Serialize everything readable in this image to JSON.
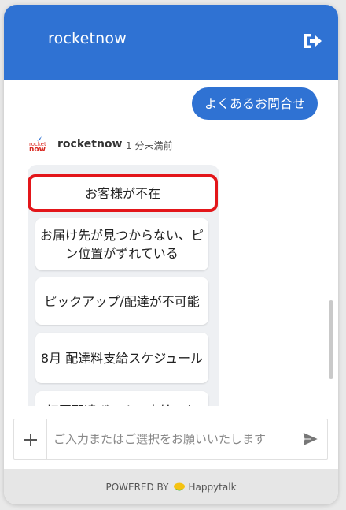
{
  "header": {
    "title": "rocketnow",
    "exit_icon": "exit-icon"
  },
  "chat": {
    "user_message": "よくあるお問合せ",
    "bot": {
      "avatar_line1": "rocket",
      "avatar_line2": "now",
      "name": "rocketnow",
      "time": "1 分未満前"
    },
    "options": [
      {
        "label": "お客様が不在",
        "selected": true
      },
      {
        "label": "お届け先が見つからない、ピン位置がずれている"
      },
      {
        "label": "ピックアップ/配達が不可能"
      },
      {
        "label": "8月 配達料支給スケジュール"
      },
      {
        "label": "初回配達ボーナス支給スケ"
      }
    ]
  },
  "input": {
    "placeholder": "ご入力またはご選択をお願いいたします",
    "value": ""
  },
  "footer": {
    "powered_by": "POWERED BY",
    "brand": "Happytalk"
  },
  "colors": {
    "accent": "#2f72d3",
    "highlight": "#e3161a",
    "brand_red": "#d9251d"
  }
}
